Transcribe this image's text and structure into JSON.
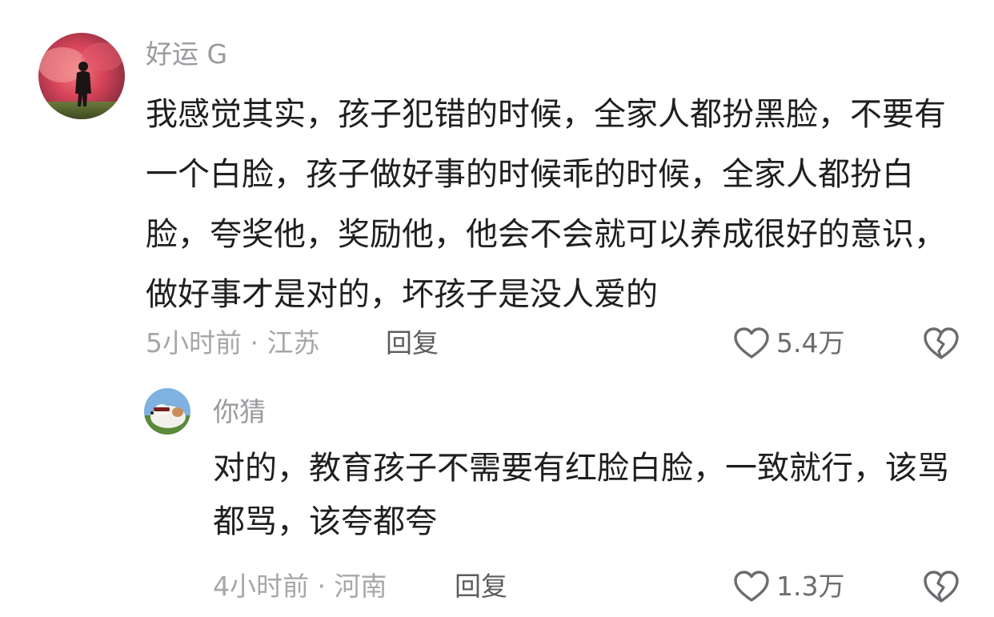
{
  "comments": [
    {
      "username": "好运 G",
      "text": "我感觉其实，孩子犯错的时候，全家人都扮黑脸，不要有一个白脸，孩子做好事的时候乖的时候，全家人都扮白脸，夸奖他，奖励他，他会不会就可以养成很好的意识，做好事才是对的，坏孩子是没人爱的",
      "time_location": "5小时前 · 江苏",
      "reply_label": "回复",
      "likes": "5.4万",
      "avatar_icon": "silhouette-in-red-smoke-avatar",
      "like_icon": "heart-outline-icon",
      "dislike_icon": "broken-heart-icon"
    },
    {
      "username": "你猜",
      "text": "对的，教育孩子不需要有红脸白脸，一致就行，该骂都骂，该夸都夸",
      "time_location": "4小时前 · 河南",
      "reply_label": "回复",
      "likes": "1.3万",
      "avatar_icon": "dog-with-sunglasses-avatar",
      "like_icon": "heart-outline-icon",
      "dislike_icon": "broken-heart-icon"
    }
  ],
  "colors": {
    "username": "#9a9a9f",
    "body_text": "#1f1f1f",
    "meta_text": "#a7a7ab",
    "reply_text": "#5c5c60",
    "icon_stroke": "#6b6b70"
  }
}
